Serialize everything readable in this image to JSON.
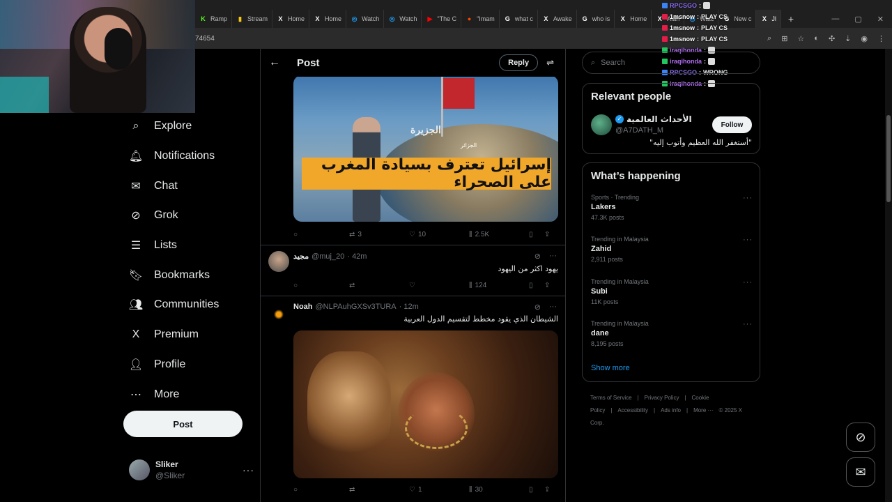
{
  "browser": {
    "tabs": [
      {
        "label": "Ramp",
        "icon": "kick-icon",
        "color": "#53fc18"
      },
      {
        "label": "Stream",
        "icon": "chart-icon",
        "color": "#f5c518"
      },
      {
        "label": "Home",
        "icon": "x-icon",
        "color": "#ffffff"
      },
      {
        "label": "Home",
        "icon": "x-icon",
        "color": "#ffffff"
      },
      {
        "label": "Watch",
        "icon": "watch-icon",
        "color": "#1d9bf0"
      },
      {
        "label": "Watch",
        "icon": "watch-icon",
        "color": "#1d9bf0"
      },
      {
        "label": "\"The C",
        "icon": "youtube-icon",
        "color": "#ff0000"
      },
      {
        "label": "\"Imam",
        "icon": "reddit-icon",
        "color": "#ff4500"
      },
      {
        "label": "what c",
        "icon": "google-icon",
        "color": "#ffffff"
      },
      {
        "label": "Awake",
        "icon": "x-icon",
        "color": "#ffffff"
      },
      {
        "label": "who is",
        "icon": "google-icon",
        "color": "#ffffff"
      },
      {
        "label": "Home",
        "icon": "x-icon",
        "color": "#ffffff"
      },
      {
        "label": "Alan",
        "icon": "x-icon",
        "color": "#ffffff"
      },
      {
        "label": "Watc",
        "icon": "watch-icon",
        "color": "#1d9bf0"
      },
      {
        "label": "New c",
        "icon": "google-icon",
        "color": "#ffffff"
      },
      {
        "label": "Jl",
        "icon": "x-icon",
        "color": "#ffffff"
      }
    ],
    "url_fragment": "74654"
  },
  "chat_overlay": [
    {
      "user": "RPCSGO",
      "message": "",
      "color": "#8c6cf2",
      "badge": "#3b82f6"
    },
    {
      "user": "1msnow",
      "message": "PLAY CS",
      "color": "#ffffff",
      "badge": "#e11d48"
    },
    {
      "user": "1msnow",
      "message": "PLAY CS",
      "color": "#ffffff",
      "badge": "#e11d48"
    },
    {
      "user": "1msnow",
      "message": "PLAY CS",
      "color": "#ffffff",
      "badge": "#e11d48"
    },
    {
      "user": "iraqihonda",
      "message": "",
      "color": "#b06cf2",
      "badge": "#22c55e"
    },
    {
      "user": "iraqihonda",
      "message": "",
      "color": "#b06cf2",
      "badge": "#22c55e"
    },
    {
      "user": "RPCSGO",
      "message": "WRONG",
      "color": "#8c6cf2",
      "badge": "#3b82f6"
    },
    {
      "user": "iraqihonda",
      "message": "",
      "color": "#b06cf2",
      "badge": "#22c55e"
    }
  ],
  "nav": {
    "items": [
      {
        "label": "Explore",
        "icon": "search-icon"
      },
      {
        "label": "Notifications",
        "icon": "bell-icon"
      },
      {
        "label": "Chat",
        "icon": "mail-icon"
      },
      {
        "label": "Grok",
        "icon": "grok-icon"
      },
      {
        "label": "Lists",
        "icon": "list-icon"
      },
      {
        "label": "Bookmarks",
        "icon": "bookmark-icon"
      },
      {
        "label": "Communities",
        "icon": "communities-icon"
      },
      {
        "label": "Premium",
        "icon": "x-logo-icon"
      },
      {
        "label": "Profile",
        "icon": "person-icon"
      },
      {
        "label": "More",
        "icon": "more-circle-icon"
      }
    ],
    "post_label": "Post"
  },
  "account": {
    "name": "Sliker",
    "handle": "@Sliker"
  },
  "main": {
    "header_title": "Post",
    "reply_label": "Reply",
    "media_banner": "إسرائيل تعترف بسيادة المغرب على الصحراء",
    "media_logo": "الجزيرة",
    "media_geo": "الجزائر",
    "first_post_stats": {
      "reposts": "3",
      "likes": "10",
      "views": "2.5K"
    },
    "replies": [
      {
        "name": "مجيد",
        "handle": "@muj_20",
        "time": "· 42m",
        "text": "يهود اكثر من اليهود",
        "stats": {
          "reposts": "",
          "likes": "",
          "views": "124"
        }
      },
      {
        "name": "Noah",
        "handle": "@NLPAuhGXSv3TURA",
        "time": "· 12m",
        "text": "الشيطان الذي يقود مخطط لتقسيم الدول العربية",
        "stats": {
          "reposts": "",
          "likes": "1",
          "views": "30"
        }
      }
    ]
  },
  "right": {
    "search_placeholder": "Search",
    "relevant_title": "Relevant people",
    "relevant_person": {
      "name": "الأحداث العالمية",
      "handle": "@A7DATH_M",
      "bio": "\"أستغفر الله العظيم وأتوب إليه\"",
      "follow_label": "Follow"
    },
    "happening_title": "What’s happening",
    "trends": [
      {
        "context": "Sports · Trending",
        "name": "Lakers",
        "count": "47.3K posts"
      },
      {
        "context": "Trending in Malaysia",
        "name": "Zahid",
        "count": "2,911 posts"
      },
      {
        "context": "Trending in Malaysia",
        "name": "Subi",
        "count": "11K posts"
      },
      {
        "context": "Trending in Malaysia",
        "name": "dane",
        "count": "8,195 posts"
      }
    ],
    "show_more": "Show more",
    "footer_links": [
      "Terms of Service",
      "|",
      "Privacy Policy",
      "|",
      "Cookie Policy",
      "|",
      "Accessibility",
      "|",
      "Ads info",
      "|",
      "More ···",
      "© 2025 X Corp."
    ]
  }
}
